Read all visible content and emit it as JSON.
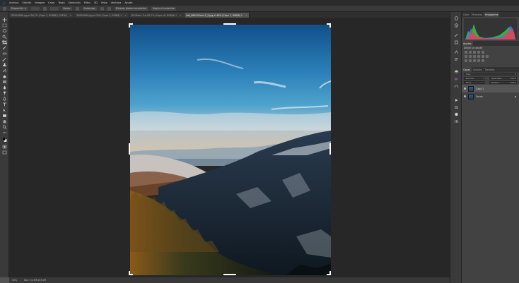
{
  "menu": {
    "items": [
      "Archivo",
      "Edición",
      "Imagen",
      "Capa",
      "Texto",
      "Selección",
      "Filtro",
      "3D",
      "Vista",
      "Ventana",
      "Ayuda"
    ]
  },
  "options": {
    "ratio": "Proporción",
    "clear": "Borrar",
    "straighten": "Enderezar",
    "delete_pixels": "Eliminar píxeles recortados",
    "content_aware": "Según el contenido"
  },
  "tabs": [
    {
      "label": "ZDS04569.jpg al 28,7% (Capa 1, RGB/8*) (CMYK)"
    },
    {
      "label": "ZDS04569.jpg al 33% (Capa 1, RGB/8) *"
    },
    {
      "label": "DS Marin-2 al 65,7% (Capa 16, RGB/8) *"
    },
    {
      "label": "Ref_9699 Primo-2_2.jpg al 40% (Capa 1, RGB/8) *",
      "active": true
    }
  ],
  "status": {
    "zoom": "40%",
    "doc_size": "Doc: 34,3M/103,0M"
  },
  "panels": {
    "top_tabs": [
      "Color",
      "Muestras",
      "Histograma"
    ],
    "adjust_tabs": [
      "Ajustes"
    ],
    "adjust_hint": "Añadir un ajuste",
    "layer_tabs": [
      "Capas",
      "Canales",
      "Trazados"
    ],
    "kind": "Tipo",
    "blend": "Normal",
    "opacity_label": "Opacidad:",
    "opacity_value": "100%",
    "lock_label": "Bloq.:",
    "fill_label": "Relleno:",
    "fill_value": "100%",
    "layers": [
      {
        "name": "Capa 1",
        "selected": true
      },
      {
        "name": "Fondo",
        "selected": false
      }
    ]
  },
  "colors": {
    "canvas_bg": "#272727",
    "ui_dark": "#3a3a3a",
    "sky_top": "#1d5f9a",
    "sky_mid": "#3f98c7",
    "haze": "#b8c7cf"
  }
}
